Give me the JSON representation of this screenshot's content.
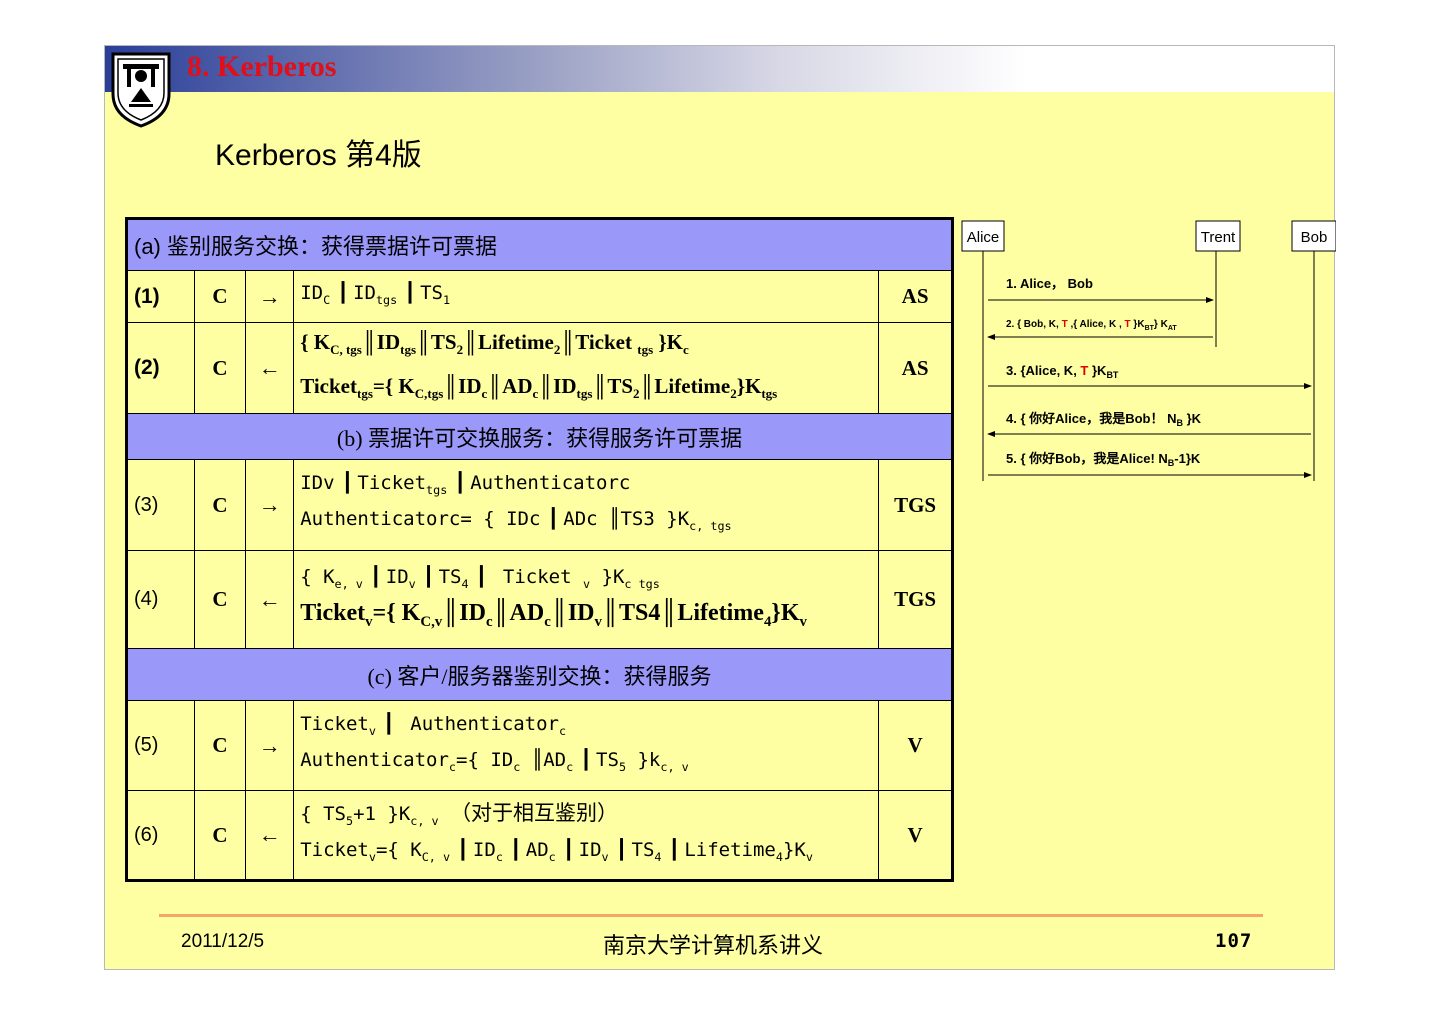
{
  "header": {
    "title": "8.   Kerberos",
    "subtitle": "Kerberos 第4版"
  },
  "table": {
    "section_a": "(a) 鉴别服务交换：获得票据许可票据",
    "section_b": "(b) 票据许可交换服务：获得服务许可票据",
    "section_c": "(c) 客户/服务器鉴别交换：获得服务",
    "rows": [
      {
        "step": "(1)",
        "party": "C",
        "arrow": "→",
        "server": "AS"
      },
      {
        "step": "(2)",
        "party": "C",
        "arrow": "←",
        "server": "AS"
      },
      {
        "step": "(3)",
        "party": "C",
        "arrow": "→",
        "server": "TGS"
      },
      {
        "step": "(4)",
        "party": "C",
        "arrow": "←",
        "server": "TGS"
      },
      {
        "step": "(5)",
        "party": "C",
        "arrow": "→",
        "server": "V"
      },
      {
        "step": "(6)",
        "party": "C",
        "arrow": "←",
        "server": "V"
      }
    ]
  },
  "sequence": {
    "actors": [
      "Alice",
      "Trent",
      "Bob"
    ],
    "messages": [
      "1.  Alice， Bob",
      "2. { Bob, K, T ,{ Alice, K , T }K",
      "3. {Alice, K, T }K",
      "4. { 你好Alice，我是Bob！ N",
      "5. { 你好Bob，我是Alice! N"
    ],
    "highlight_color": "#e00000"
  },
  "footer": {
    "date": "2011/12/5",
    "lecture": "南京大学计算机系讲义",
    "page": "107"
  }
}
